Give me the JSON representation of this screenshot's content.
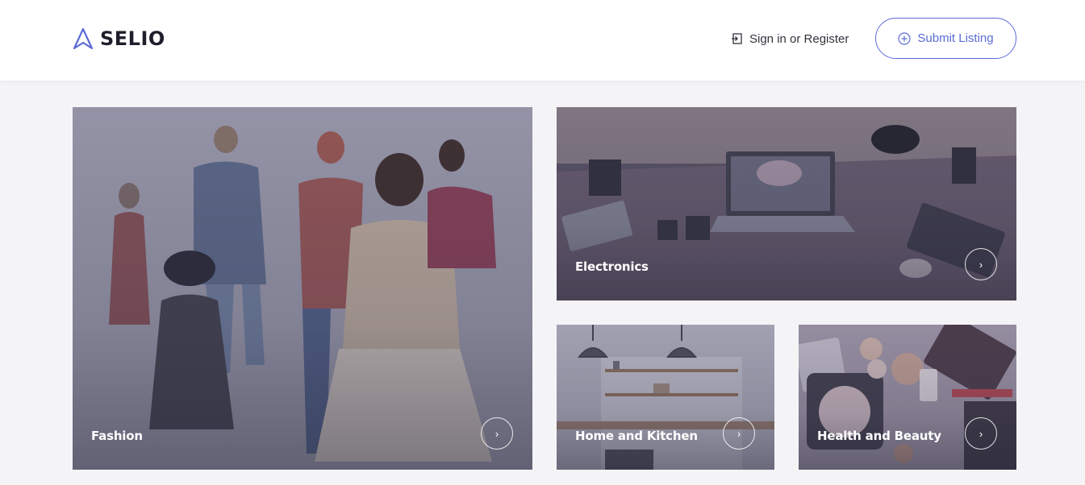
{
  "brand": {
    "name": "SELIO",
    "accent": "#5b6bd6"
  },
  "header": {
    "signin": {
      "icon": "sign-in-icon",
      "label": "Sign in or Register"
    },
    "submit": {
      "icon": "plus-circle-icon",
      "label": "Submit Listing"
    }
  },
  "categories": [
    {
      "label": "Fashion",
      "arrow": "›"
    },
    {
      "label": "Electronics",
      "arrow": "›"
    },
    {
      "label": "Home and Kitchen",
      "arrow": "›"
    },
    {
      "label": "Health and Beauty",
      "arrow": "›"
    }
  ]
}
